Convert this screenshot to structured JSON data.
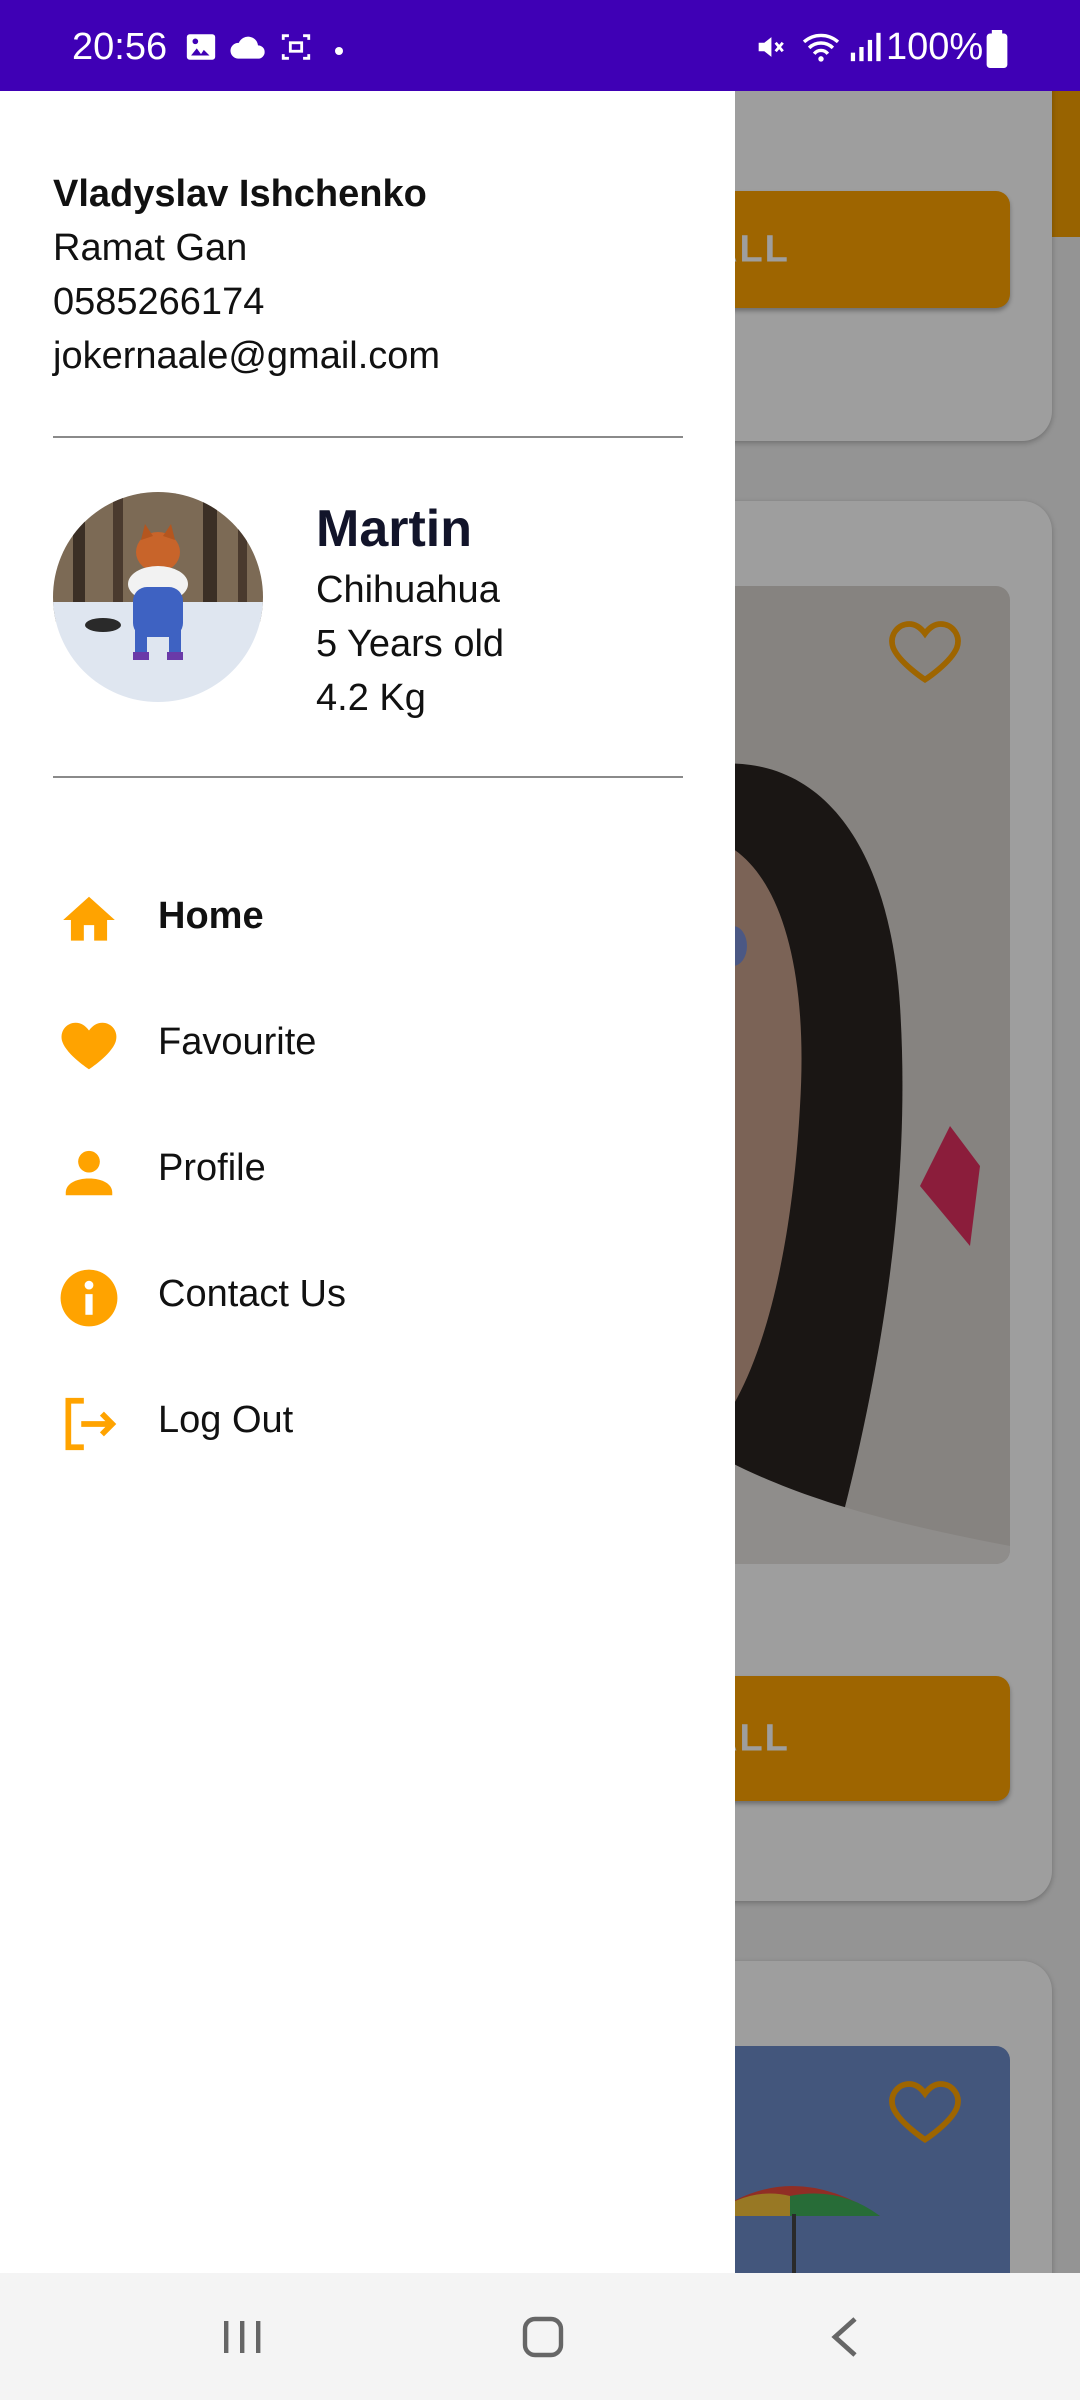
{
  "status_bar": {
    "time": "20:56",
    "battery_percent": "100%",
    "icons": [
      "image-icon",
      "cloud-icon",
      "screen-record-icon",
      "dot-icon",
      "mute-icon",
      "wifi-icon",
      "signal-icon",
      "battery-icon"
    ]
  },
  "background": {
    "button_label_1": "ALL",
    "button_label_2": "ALL",
    "accent_color": "#ffa300"
  },
  "drawer": {
    "owner": {
      "name": "Vladyslav Ishchenko",
      "city": "Ramat Gan",
      "phone": "0585266174",
      "email": "jokernaale@gmail.com"
    },
    "pet": {
      "name": "Martin",
      "breed": "Chihuahua",
      "age": "5 Years old",
      "weight": "4.2 Kg"
    },
    "menu": [
      {
        "label": "Home",
        "icon": "home-icon"
      },
      {
        "label": "Favourite",
        "icon": "heart-icon"
      },
      {
        "label": "Profile",
        "icon": "person-icon"
      },
      {
        "label": "Contact Us",
        "icon": "info-icon"
      },
      {
        "label": "Log Out",
        "icon": "logout-icon"
      }
    ]
  },
  "colors": {
    "status_bar": "#3f00b5",
    "icon_orange": "#ffa300"
  }
}
